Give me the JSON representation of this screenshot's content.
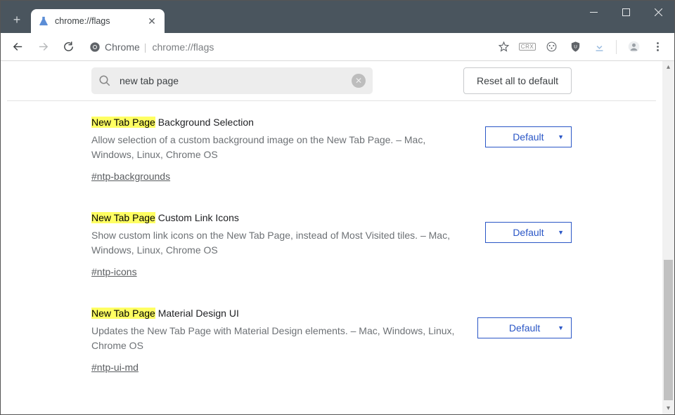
{
  "window": {
    "tab_title": "chrome://flags"
  },
  "toolbar": {
    "chrome_label": "Chrome",
    "url": "chrome://flags",
    "crx_badge": "CRX"
  },
  "flags_page": {
    "search_value": "new tab page",
    "reset_label": "Reset all to default",
    "items": [
      {
        "highlight": "New Tab Page",
        "title_rest": " Background Selection",
        "desc": "Allow selection of a custom background image on the New Tab Page. – Mac, Windows, Linux, Chrome OS",
        "anchor": "#ntp-backgrounds",
        "select": "Default"
      },
      {
        "highlight": "New Tab Page",
        "title_rest": " Custom Link Icons",
        "desc": "Show custom link icons on the New Tab Page, instead of Most Visited tiles. – Mac, Windows, Linux, Chrome OS",
        "anchor": "#ntp-icons",
        "select": "Default"
      },
      {
        "highlight": "New Tab Page",
        "title_rest": " Material Design UI",
        "desc": "Updates the New Tab Page with Material Design elements. – Mac, Windows, Linux, Chrome OS",
        "anchor": "#ntp-ui-md",
        "select": "Default"
      }
    ]
  }
}
